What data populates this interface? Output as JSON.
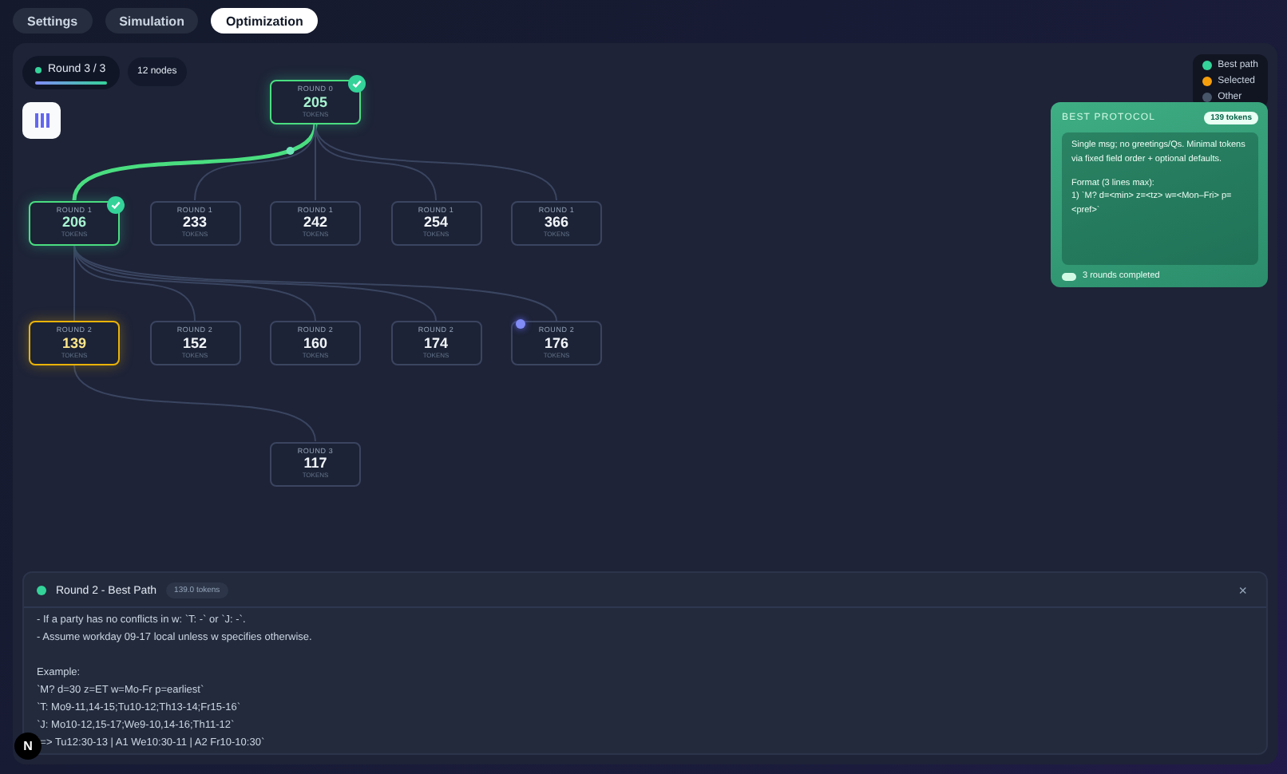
{
  "tabs": [
    {
      "label": "Settings",
      "selected": false
    },
    {
      "label": "Simulation",
      "selected": false
    },
    {
      "label": "Optimization",
      "selected": true
    }
  ],
  "round_badge": {
    "label": "Round 3 / 3",
    "level": 1.0
  },
  "node_count": "12 nodes",
  "tree": {
    "label": "ROUND 0",
    "value": "205",
    "unit": "TOKENS",
    "best_path": true,
    "selected": false,
    "checked": true,
    "marked": false,
    "children": [
      {
        "label": "ROUND 1",
        "value": "206",
        "unit": "TOKENS",
        "best_path": true,
        "selected": false,
        "checked": true,
        "marked": false,
        "children": [
          {
            "label": "ROUND 2",
            "value": "139",
            "unit": "TOKENS",
            "best_path": false,
            "selected": true,
            "checked": false,
            "marked": false,
            "children": [
              {
                "label": "ROUND 3",
                "value": "117",
                "unit": "TOKENS",
                "best_path": false,
                "selected": false,
                "checked": false,
                "marked": false
              }
            ]
          },
          {
            "label": "ROUND 2",
            "value": "152",
            "unit": "TOKENS",
            "best_path": false,
            "selected": false,
            "checked": false,
            "marked": false
          },
          {
            "label": "ROUND 2",
            "value": "160",
            "unit": "TOKENS",
            "best_path": false,
            "selected": false,
            "checked": false,
            "marked": false
          },
          {
            "label": "ROUND 2",
            "value": "174",
            "unit": "TOKENS",
            "best_path": false,
            "selected": false,
            "checked": false,
            "marked": false
          },
          {
            "label": "ROUND 2",
            "value": "176",
            "unit": "TOKENS",
            "best_path": false,
            "selected": false,
            "checked": false,
            "marked": true
          }
        ]
      },
      {
        "label": "ROUND 1",
        "value": "233",
        "unit": "TOKENS",
        "best_path": false,
        "selected": false,
        "checked": false,
        "marked": false
      },
      {
        "label": "ROUND 1",
        "value": "242",
        "unit": "TOKENS",
        "best_path": false,
        "selected": false,
        "checked": false,
        "marked": false
      },
      {
        "label": "ROUND 1",
        "value": "254",
        "unit": "TOKENS",
        "best_path": false,
        "selected": false,
        "checked": false,
        "marked": false
      },
      {
        "label": "ROUND 1",
        "value": "366",
        "unit": "TOKENS",
        "best_path": false,
        "selected": false,
        "checked": false,
        "marked": false
      }
    ]
  },
  "legend": [
    {
      "label": "Best path",
      "color": "#34d399"
    },
    {
      "label": "Selected",
      "color": "#f59e0b"
    },
    {
      "label": "Other",
      "color": "#475569"
    }
  ],
  "best_protocol": {
    "title": "BEST PROTOCOL",
    "badge": "139 tokens",
    "paragraphs": [
      "Single msg; no greetings/Qs. Minimal tokens via fixed field order + optional defaults.",
      "Format (3 lines max):\n1) `M? d=<min> z=<tz> w=<Mon–Fri> p=<pref>`"
    ],
    "footer": "3 rounds completed"
  },
  "detail": {
    "title": "Round 2 - Best Path",
    "badge": "139.0 tokens",
    "close": "×",
    "blocks": [
      [
        "- If a party has no conflicts in w: `T: -` or `J: -`.",
        "- Assume workday 09-17 local unless w specifies otherwise."
      ],
      [
        "Example:",
        "`M? d=30 z=ET w=Mo-Fr p=earliest`",
        "`T: Mo9-11,14-15;Tu10-12;Th13-14;Fr15-16`",
        "`J: Mo10-12,15-17;We9-10,14-16;Th11-12`",
        "`=> Tu12:30-13 | A1 We10:30-11 | A2 Fr10-10:30`"
      ]
    ]
  },
  "dev_badge": "N"
}
